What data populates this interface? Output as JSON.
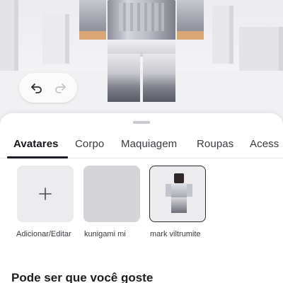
{
  "preview": {
    "undo_icon": "undo-icon",
    "redo_icon": "redo-icon"
  },
  "tabs": [
    {
      "label": "Avatares",
      "active": true
    },
    {
      "label": "Corpo",
      "active": false
    },
    {
      "label": "Maquiagem",
      "active": false
    },
    {
      "label": "Roupas",
      "active": false
    },
    {
      "label": "Acess",
      "active": false
    }
  ],
  "avatars": [
    {
      "label": "Adicionar/Editar",
      "icon": "plus-icon"
    },
    {
      "label": "kunigami mi"
    },
    {
      "label": "mark viltrumite",
      "selected": true
    }
  ],
  "section": {
    "title": "Pode ser que você goste"
  },
  "colors": {
    "accent": "#1c1d22",
    "tile": "#ececef",
    "tile_dark": "#d4d4d9"
  }
}
